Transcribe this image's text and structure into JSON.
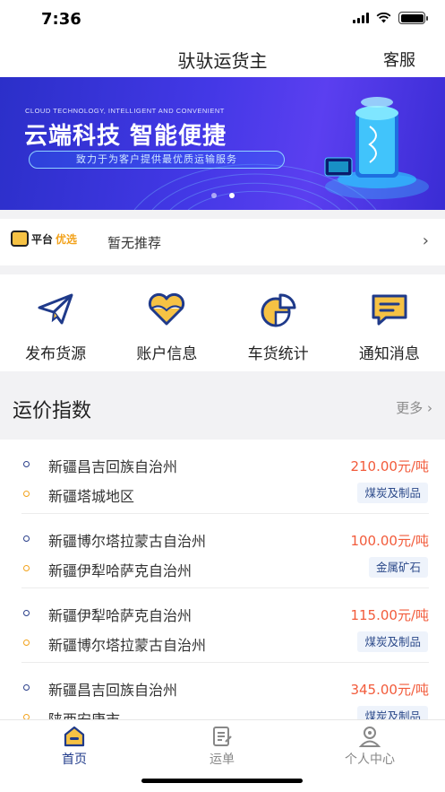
{
  "status": {
    "time": "7:36"
  },
  "nav": {
    "title": "驮驮运货主",
    "service": "客服"
  },
  "banner": {
    "subtitle": "CLOUD TECHNOLOGY, INTELLIGENT AND CONVENIENT",
    "title": "云端科技 智能便捷",
    "tagline": "致力于为客户提供最优质运输服务",
    "slides_total": 2,
    "slide_active": 2
  },
  "recommend": {
    "logo_part1": "平台",
    "logo_part2": "优选",
    "text": "暂无推荐",
    "arrow": "›"
  },
  "actions": [
    {
      "label": "发布货源",
      "icon": "paper-plane-icon"
    },
    {
      "label": "账户信息",
      "icon": "heart-icon"
    },
    {
      "label": "车货统计",
      "icon": "pie-chart-icon"
    },
    {
      "label": "通知消息",
      "icon": "message-icon"
    }
  ],
  "freight_index": {
    "title": "运价指数",
    "more": "更多 ›",
    "rows": [
      {
        "from": "新疆昌吉回族自治州",
        "to": "新疆塔城地区",
        "price": "210.00元/吨",
        "cargo": "煤炭及制品"
      },
      {
        "from": "新疆博尔塔拉蒙古自治州",
        "to": "新疆伊犁哈萨克自治州",
        "price": "100.00元/吨",
        "cargo": "金属矿石"
      },
      {
        "from": "新疆伊犁哈萨克自治州",
        "to": "新疆博尔塔拉蒙古自治州",
        "price": "115.00元/吨",
        "cargo": "煤炭及制品"
      },
      {
        "from": "新疆昌吉回族自治州",
        "to": "陕西安康市",
        "price": "345.00元/吨",
        "cargo": "煤炭及制品"
      }
    ]
  },
  "tabbar": {
    "tabs": [
      {
        "label": "首页",
        "icon": "home-icon",
        "active": true
      },
      {
        "label": "运单",
        "icon": "waybill-icon",
        "active": false
      },
      {
        "label": "个人中心",
        "icon": "profile-icon",
        "active": false
      }
    ]
  },
  "colors": {
    "brand_blue": "#1f3a8a",
    "accent_yellow": "#f6c244",
    "price_red": "#f25b3b"
  }
}
